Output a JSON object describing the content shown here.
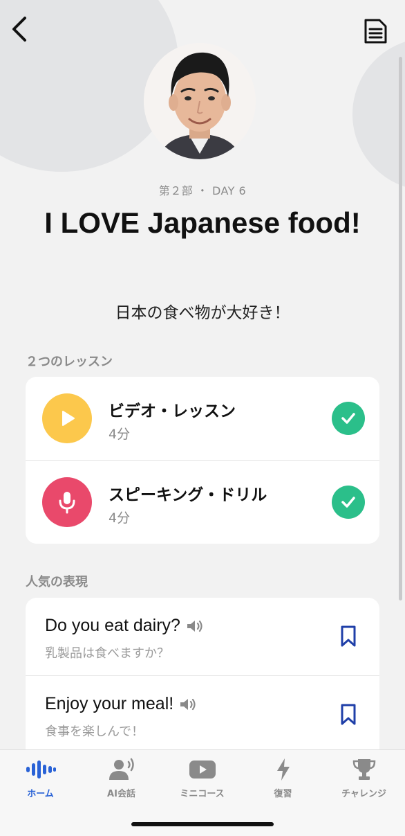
{
  "header": {
    "part_day": "第２部 ・ DAY 6",
    "title": "I LOVE Japanese food!",
    "title_jp": "日本の食べ物が大好き！"
  },
  "lessons": {
    "section_label": "２つのレッスン",
    "items": [
      {
        "title": "ビデオ・レッスン",
        "duration": "4分",
        "icon": "play-icon",
        "color": "#fcc84c",
        "completed": true
      },
      {
        "title": "スピーキング・ドリル",
        "duration": "4分",
        "icon": "microphone-icon",
        "color": "#e9496b",
        "completed": true
      }
    ]
  },
  "phrases": {
    "section_label": "人気の表現",
    "items": [
      {
        "en": "Do you eat dairy?",
        "jp": "乳製品は食べますか？"
      },
      {
        "en": "Enjoy your meal!",
        "jp": "食事を楽しんで！"
      }
    ]
  },
  "tabs": [
    {
      "label": "ホーム",
      "icon": "waveform-icon",
      "active": true
    },
    {
      "label": "AI会話",
      "icon": "ai-speaker-icon",
      "active": false
    },
    {
      "label": "ミニコース",
      "icon": "video-play-icon",
      "active": false
    },
    {
      "label": "復習",
      "icon": "lightning-icon",
      "active": false
    },
    {
      "label": "チャレンジ",
      "icon": "trophy-icon",
      "active": false
    }
  ],
  "colors": {
    "accent": "#2962d6",
    "check": "#2bbf8a",
    "bookmark": "#1f3fa8"
  }
}
